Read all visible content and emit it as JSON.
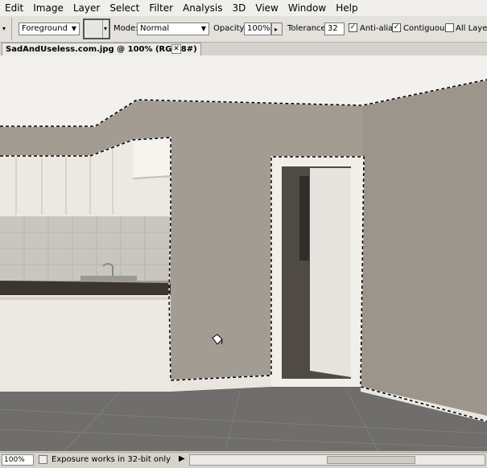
{
  "menu": [
    "Edit",
    "Image",
    "Layer",
    "Select",
    "Filter",
    "Analysis",
    "3D",
    "View",
    "Window",
    "Help"
  ],
  "options": {
    "fill_source": "Foreground",
    "mode_label": "Mode:",
    "mode_value": "Normal",
    "opacity_label": "Opacity:",
    "opacity_value": "100%",
    "tolerance_label": "Tolerance:",
    "tolerance_value": "32",
    "antialias_label": "Anti-alias",
    "contiguous_label": "Contiguous",
    "all_layers_label": "All Layers",
    "antialias_checked": true,
    "contiguous_checked": true,
    "all_layers_checked": false
  },
  "document": {
    "tab_title": "SadAndUseless.com.jpg @ 100% (RGB/8#)",
    "close_glyph": "✕"
  },
  "status": {
    "zoom": "100%",
    "message": "Exposure works in 32-bit only",
    "play_glyph": "▶"
  },
  "icons": {
    "tool_preset": "paint-bucket-icon",
    "cursor": "paint-bucket-cursor-icon"
  },
  "colors": {
    "wall": "#a39c92",
    "ceiling": "#f3f1ed",
    "floor": "#6f6e6c",
    "cabinet": "#ece9e2",
    "benchtop": "#3b3430",
    "door": "#e6e4df"
  }
}
